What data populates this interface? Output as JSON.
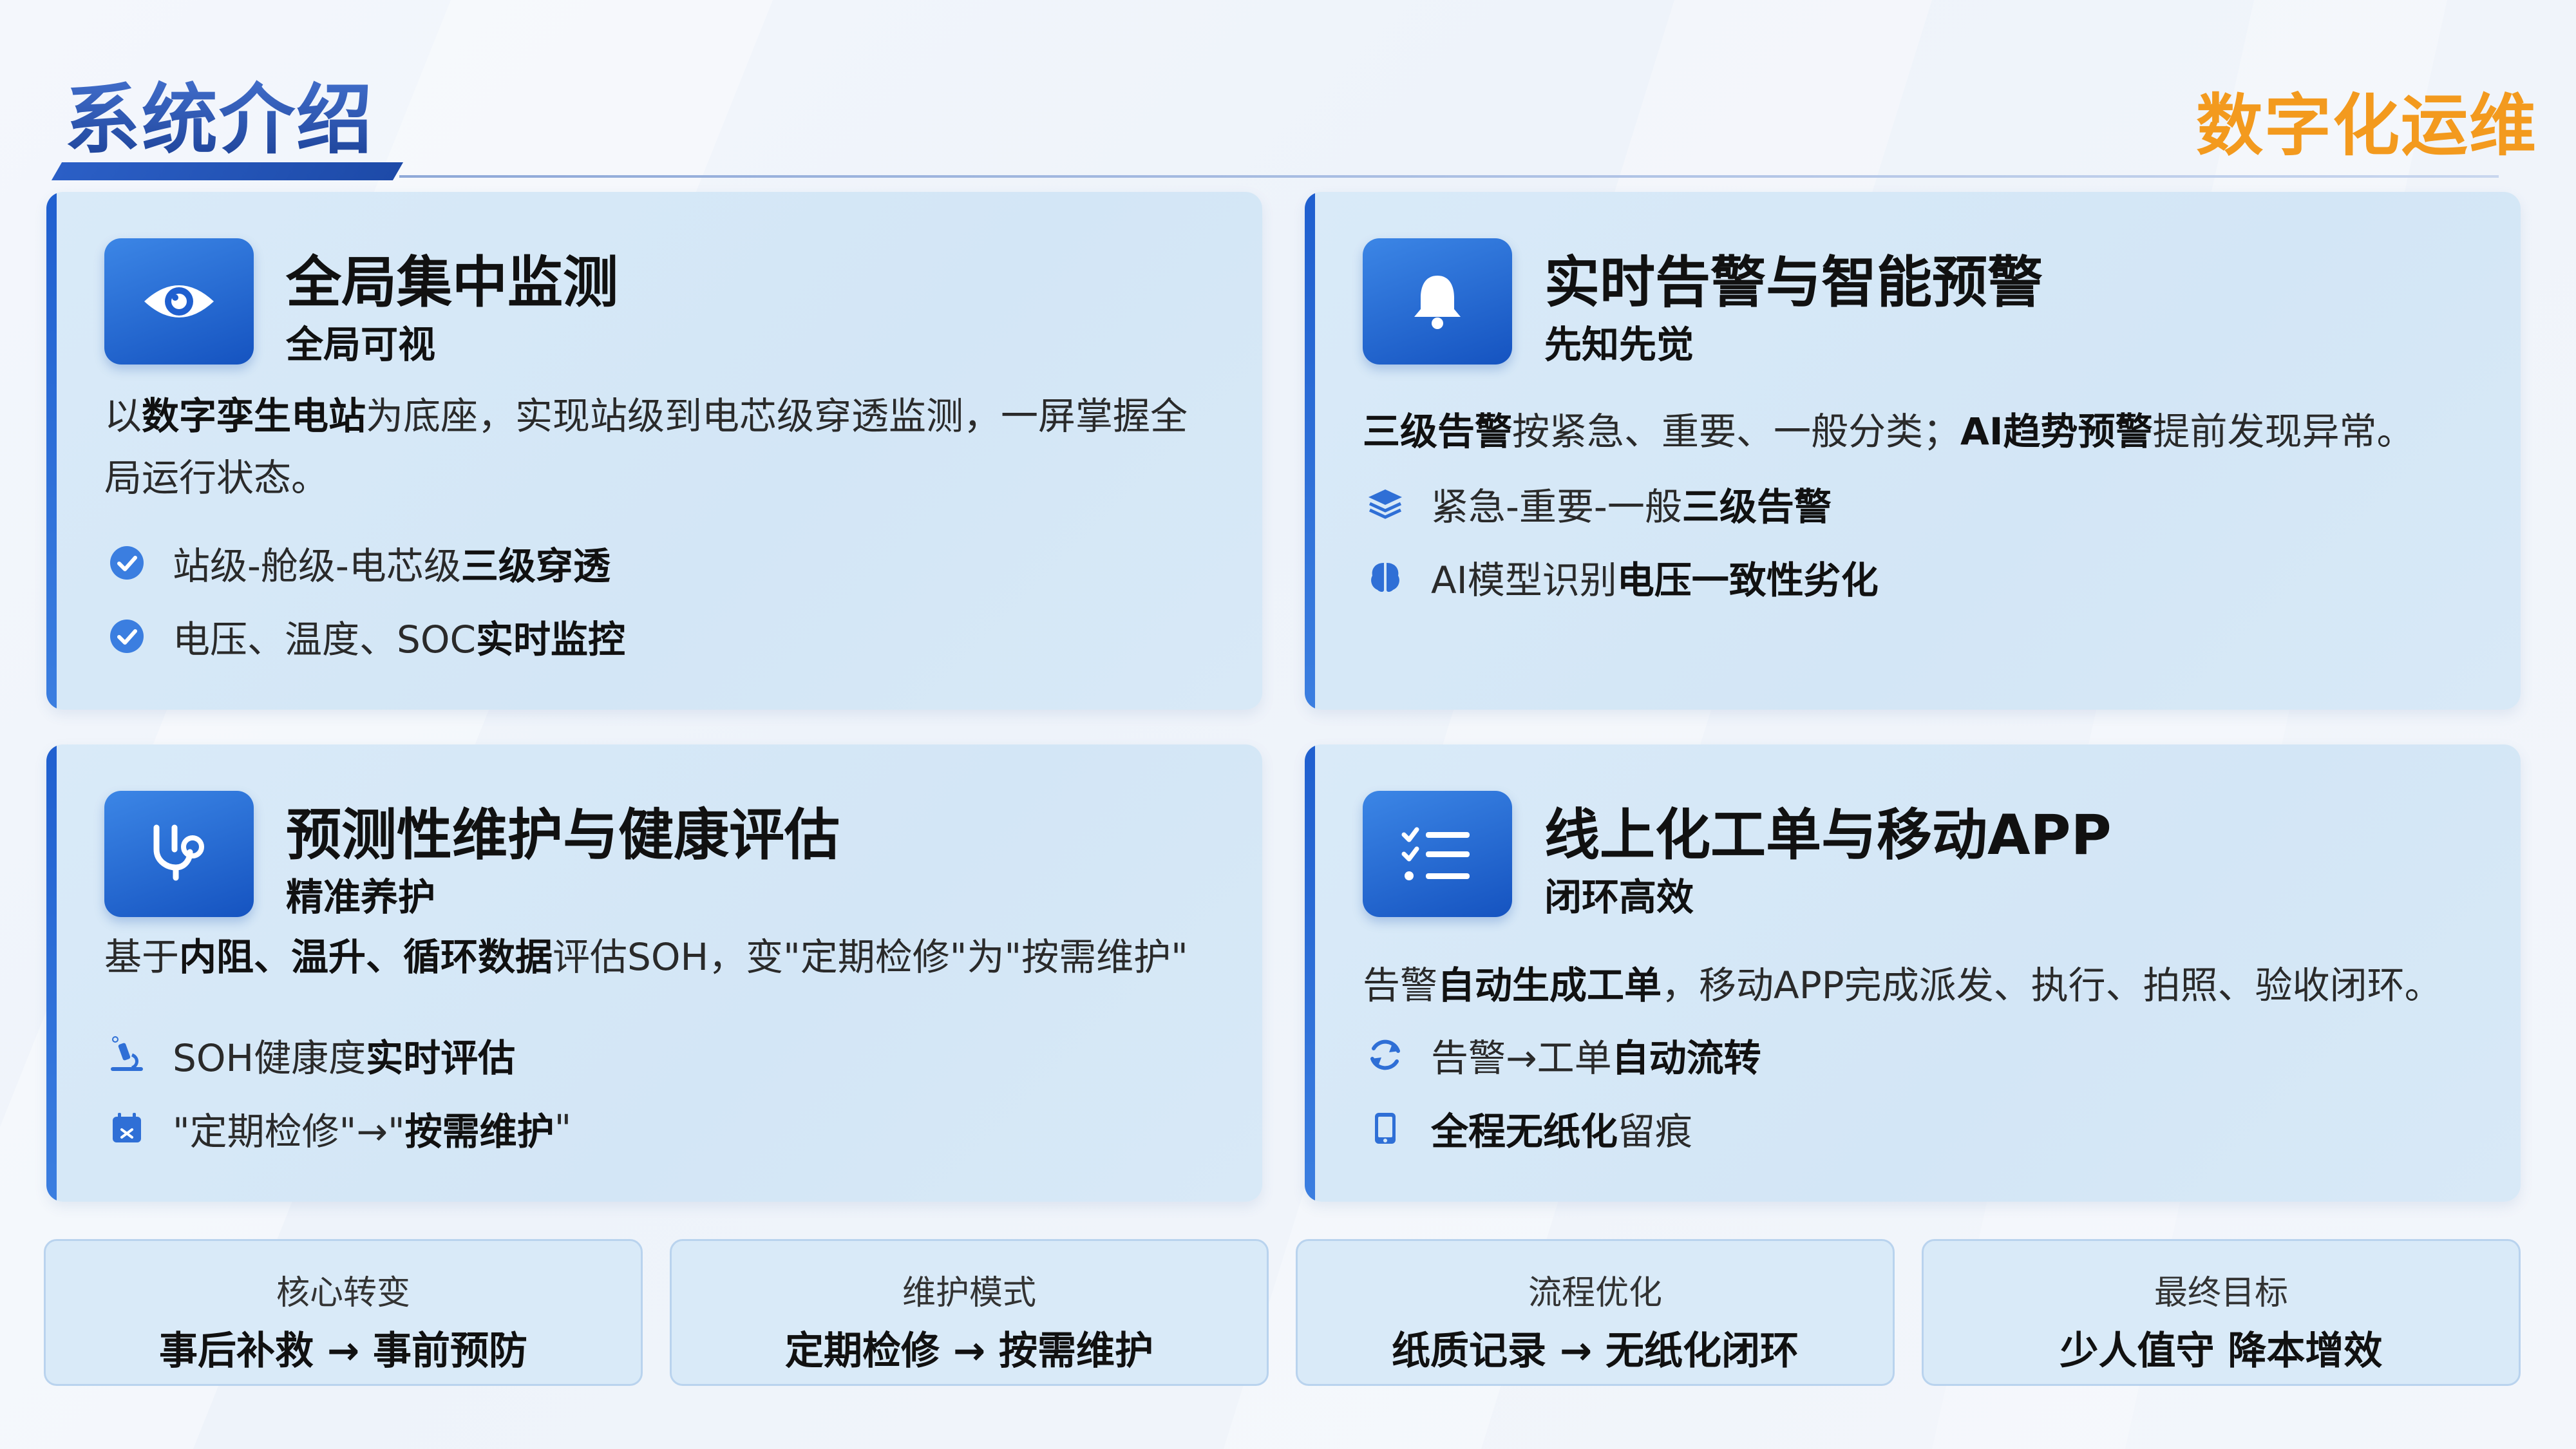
{
  "header": {
    "title": "系统介绍",
    "brand": "数字化运维"
  },
  "cards": [
    {
      "title": "全局集中监测",
      "subtitle": "全局可视",
      "icon": "eye-icon",
      "desc_parts": [
        "以",
        "数字孪生电站",
        "为底座，实现站级到电芯级穿透监测，一屏掌握全局运行状态。"
      ],
      "bullets": [
        {
          "icon": "check-circle-icon",
          "text": "站级-舱级-电芯级",
          "bold": "三级穿透"
        },
        {
          "icon": "check-circle-icon",
          "text": "电压、温度、SOC",
          "bold": "实时监控"
        }
      ]
    },
    {
      "title": "实时告警与智能预警",
      "subtitle": "先知先觉",
      "icon": "bell-icon",
      "desc_parts": [
        "三级告警",
        "按紧急、重要、一般分类；",
        "AI趋势预警",
        "提前发现异常。"
      ],
      "bullets": [
        {
          "icon": "layers-icon",
          "text": "紧急-重要-一般",
          "bold": "三级告警"
        },
        {
          "icon": "brain-icon",
          "text": "AI模型识别",
          "bold": "电压一致性劣化"
        }
      ]
    },
    {
      "title": "预测性维护与健康评估",
      "subtitle": "精准养护",
      "icon": "stethoscope-icon",
      "desc_parts": [
        "基于",
        "内阻、温升、循环数据",
        "评估SOH，变\"定期检修\"为\"按需维护\""
      ],
      "bullets": [
        {
          "icon": "microscope-icon",
          "text": "SOH健康度",
          "bold": "实时评估"
        },
        {
          "icon": "calendar-icon",
          "text": "\"定期检修\"→\"",
          "bold": "按需维护",
          "tail": "\""
        }
      ]
    },
    {
      "title": "线上化工单与移动APP",
      "subtitle": "闭环高效",
      "icon": "checklist-icon",
      "desc_parts": [
        "告警",
        "自动生成工单",
        "，移动APP完成派发、执行、拍照、验收闭环。"
      ],
      "bullets": [
        {
          "icon": "refresh-icon",
          "text": "告警→工单",
          "bold": "自动流转"
        },
        {
          "icon": "tablet-icon",
          "text": "",
          "bold": "全程无纸化",
          "tail": "留痕"
        }
      ]
    }
  ],
  "footer": [
    {
      "label": "核心转变",
      "value": "事后补救 → 事前预防"
    },
    {
      "label": "维护模式",
      "value": "定期检修 → 按需维护"
    },
    {
      "label": "流程优化",
      "value": "纸质记录 → 无纸化闭环"
    },
    {
      "label": "最终目标",
      "value": "少人值守 降本增效"
    }
  ],
  "colors": {
    "primary": "#1f5fcf",
    "accent": "#f39a1e",
    "card_bg": "#d6e8f7"
  }
}
